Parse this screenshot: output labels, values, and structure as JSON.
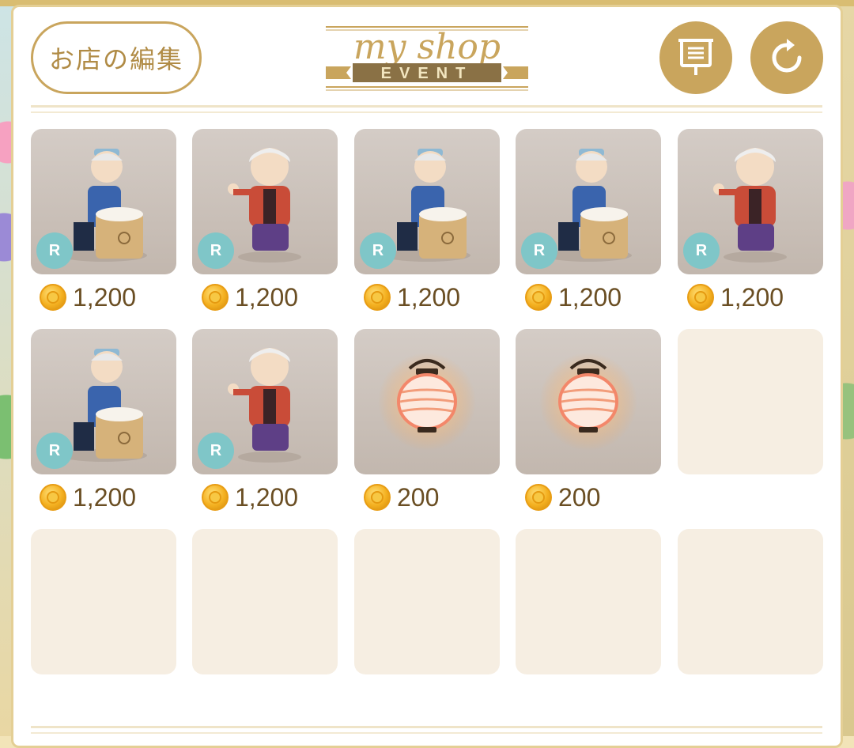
{
  "header": {
    "edit_button_label": "お店の編集",
    "logo_title": "my shop",
    "logo_subtitle": "EVENT",
    "icons": [
      "signboard-icon",
      "refresh-icon"
    ]
  },
  "colors": {
    "gold": "#c9a55d",
    "empty_slot": "#f6eee2",
    "rarity_badge": "#7fc6c8",
    "price_text": "#6a4e23"
  },
  "slots": [
    {
      "item": "old-man-mochi",
      "rarity": "R",
      "price": "1,200"
    },
    {
      "item": "old-woman",
      "rarity": "R",
      "price": "1,200"
    },
    {
      "item": "old-man-mochi",
      "rarity": "R",
      "price": "1,200"
    },
    {
      "item": "old-man-mochi",
      "rarity": "R",
      "price": "1,200"
    },
    {
      "item": "old-woman",
      "rarity": "R",
      "price": "1,200"
    },
    {
      "item": "old-man-mochi",
      "rarity": "R",
      "price": "1,200"
    },
    {
      "item": "old-woman",
      "rarity": "R",
      "price": "1,200"
    },
    {
      "item": "paper-lantern",
      "rarity": "",
      "price": "200"
    },
    {
      "item": "paper-lantern",
      "rarity": "",
      "price": "200"
    },
    {
      "item": "",
      "rarity": "",
      "price": ""
    },
    {
      "item": "",
      "rarity": "",
      "price": ""
    },
    {
      "item": "",
      "rarity": "",
      "price": ""
    },
    {
      "item": "",
      "rarity": "",
      "price": ""
    },
    {
      "item": "",
      "rarity": "",
      "price": ""
    },
    {
      "item": "",
      "rarity": "",
      "price": ""
    }
  ]
}
